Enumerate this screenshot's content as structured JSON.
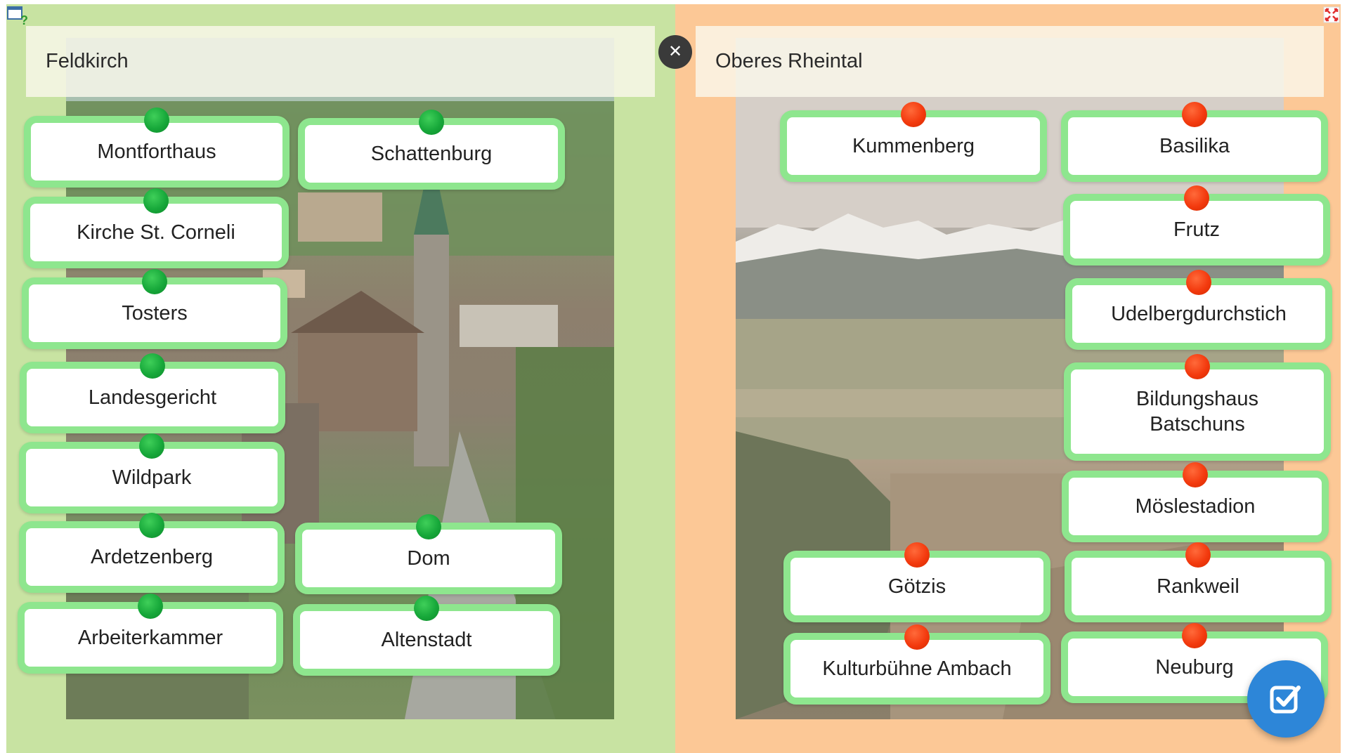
{
  "left_group": {
    "title": "Feldkirch",
    "cards": [
      {
        "label": "Montforthaus"
      },
      {
        "label": "Schattenburg"
      },
      {
        "label": "Kirche St. Corneli"
      },
      {
        "label": "Tosters"
      },
      {
        "label": "Landesgericht"
      },
      {
        "label": "Wildpark"
      },
      {
        "label": "Ardetzenberg"
      },
      {
        "label": "Dom"
      },
      {
        "label": "Arbeiterkammer"
      },
      {
        "label": "Altenstadt"
      }
    ],
    "connector_color": "#17a83a"
  },
  "right_group": {
    "title": "Oberes Rheintal",
    "cards": [
      {
        "label": "Kummenberg"
      },
      {
        "label": "Basilika"
      },
      {
        "label": "Frutz"
      },
      {
        "label": "Udelbergdurchstich"
      },
      {
        "label": "Bildungshaus Batschuns"
      },
      {
        "label": "Möslestadion"
      },
      {
        "label": "Götzis"
      },
      {
        "label": "Rankweil"
      },
      {
        "label": "Kulturbühne Ambach"
      },
      {
        "label": "Neuburg"
      }
    ],
    "connector_color": "#f33a0e"
  },
  "colors": {
    "left_panel": "#c8e3a2",
    "right_panel": "#fcc896",
    "card_border": "#8ee68e",
    "check_button": "#2d86d8"
  },
  "icons": {
    "help": "help-icon",
    "close": "close-icon",
    "fullscreen": "fullscreen-icon",
    "check": "check-icon"
  }
}
